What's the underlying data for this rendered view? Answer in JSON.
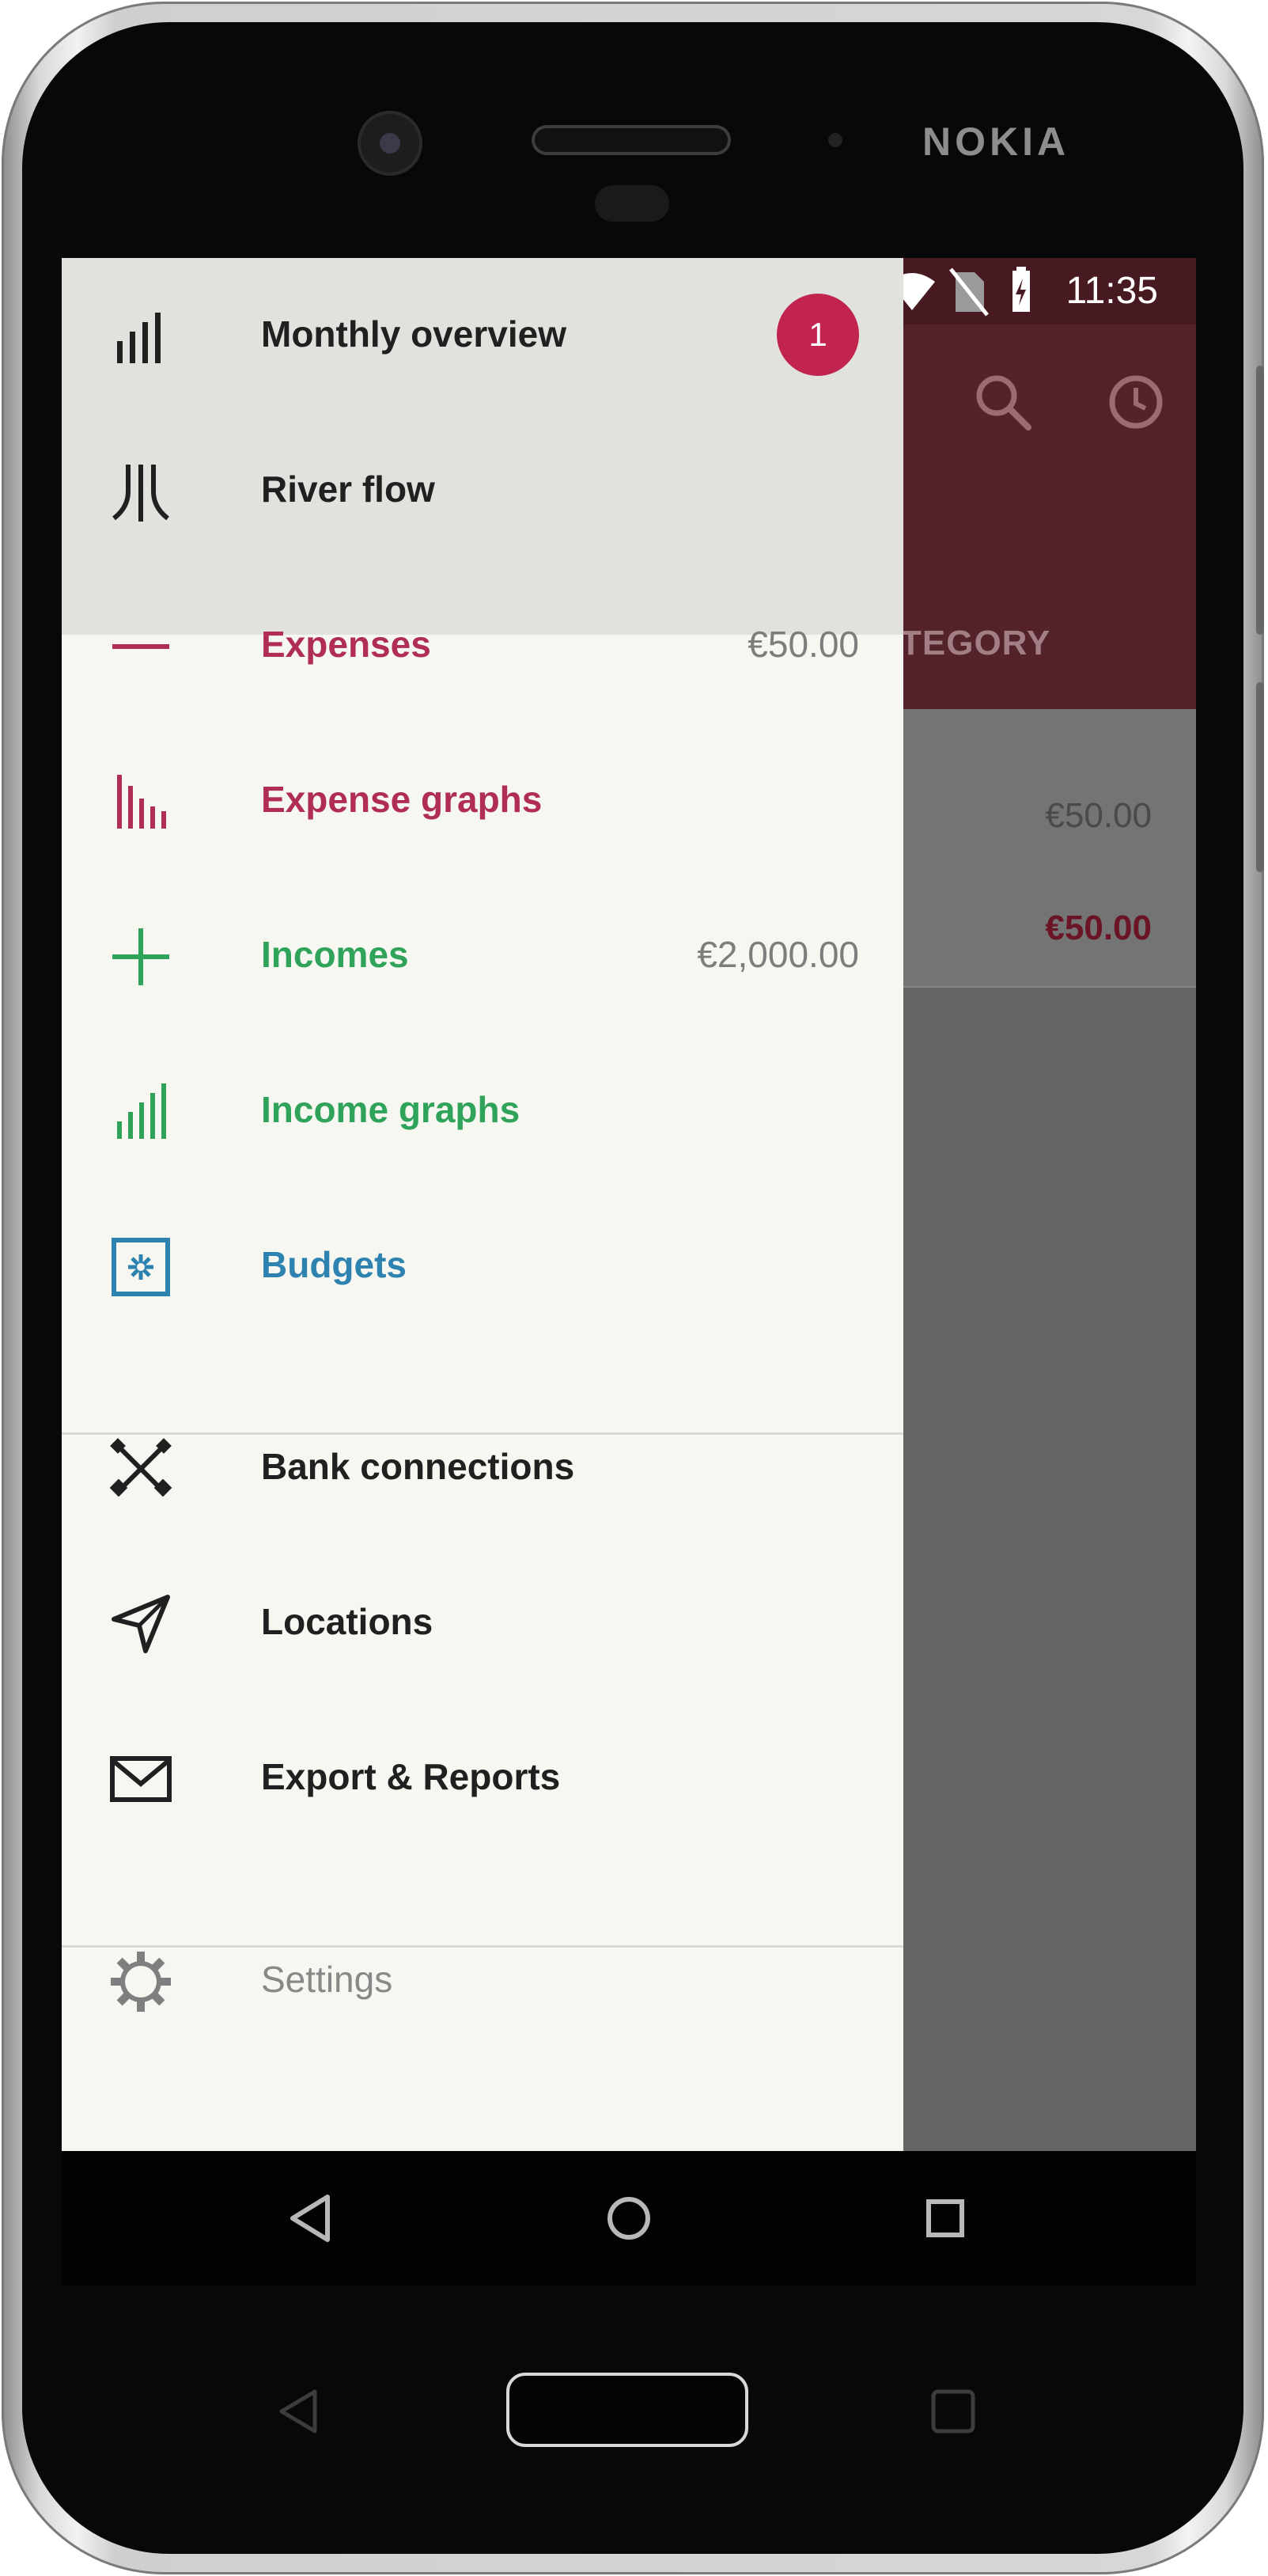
{
  "device": {
    "brand": "NOKIA"
  },
  "status_bar": {
    "time": "11:35"
  },
  "background_app": {
    "tab_label": "TEGORY",
    "row_amount_1": "€50.00",
    "row_amount_2": "€50.00",
    "accent": "#54222a",
    "amount_accent": "#6a1426"
  },
  "drawer": {
    "items": [
      {
        "label": "Monthly overview",
        "badge": "1",
        "icon": "bar-chart-icon",
        "color": "#202020"
      },
      {
        "label": "River flow",
        "icon": "river-flow-icon",
        "color": "#202020"
      },
      {
        "label": "Expenses",
        "amount": "€50.00",
        "icon": "minus-icon",
        "color": "#b02d56"
      },
      {
        "label": "Expense graphs",
        "icon": "expense-graph-icon",
        "color": "#b02d56"
      },
      {
        "label": "Incomes",
        "amount": "€2,000.00",
        "icon": "plus-icon",
        "color": "#2fa35a"
      },
      {
        "label": "Income graphs",
        "icon": "income-graph-icon",
        "color": "#2fa35a"
      },
      {
        "label": "Budgets",
        "icon": "budget-icon",
        "color": "#2e82b0"
      },
      {
        "label": "Bank connections",
        "icon": "bank-connections-icon",
        "color": "#202020"
      },
      {
        "label": "Locations",
        "icon": "location-arrow-icon",
        "color": "#202020"
      },
      {
        "label": "Export &  Reports",
        "icon": "mail-icon",
        "color": "#202020"
      },
      {
        "label": "Settings",
        "icon": "gear-icon",
        "color": "#888888"
      }
    ]
  },
  "nav_bar": {
    "back": "back-icon",
    "home": "home-icon",
    "recents": "recents-icon"
  }
}
